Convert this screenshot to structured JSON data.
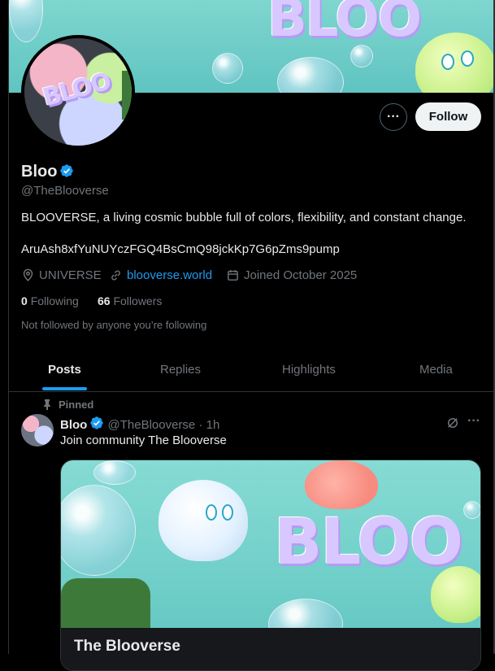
{
  "profile": {
    "name": "Bloo",
    "handle": "@TheBlooverse",
    "bio": "BLOOVERSE, a living cosmic bubble full of colors, flexibility, and constant change.",
    "contract": "AruAsh8xfYuNUYczFGQ4BsCmQ98jckKp7G6pZms9pump",
    "location": "UNIVERSE",
    "website": "blooverse.world",
    "joined": "Joined October 2025",
    "following_count": "0",
    "following_label": "Following",
    "followers_count": "66",
    "followers_label": "Followers",
    "not_followed": "Not followed by anyone you’re following",
    "follow_label": "Follow",
    "more_label": "···"
  },
  "banner": {
    "logo_text": "BLOO"
  },
  "tabs": [
    {
      "label": "Posts",
      "active": true
    },
    {
      "label": "Replies",
      "active": false
    },
    {
      "label": "Highlights",
      "active": false
    },
    {
      "label": "Media",
      "active": false
    }
  ],
  "post": {
    "pinned_label": "Pinned",
    "author": "Bloo",
    "handle": "@TheBlooverse",
    "separator": "·",
    "time": "1h",
    "text": "Join community The Blooverse",
    "more_label": "···",
    "card": {
      "title": "The Blooverse",
      "logo_text": "BLOO"
    }
  },
  "colors": {
    "accent": "#1d9bf0",
    "background": "#000000",
    "muted": "#71767b",
    "text": "#e7e9ea"
  }
}
